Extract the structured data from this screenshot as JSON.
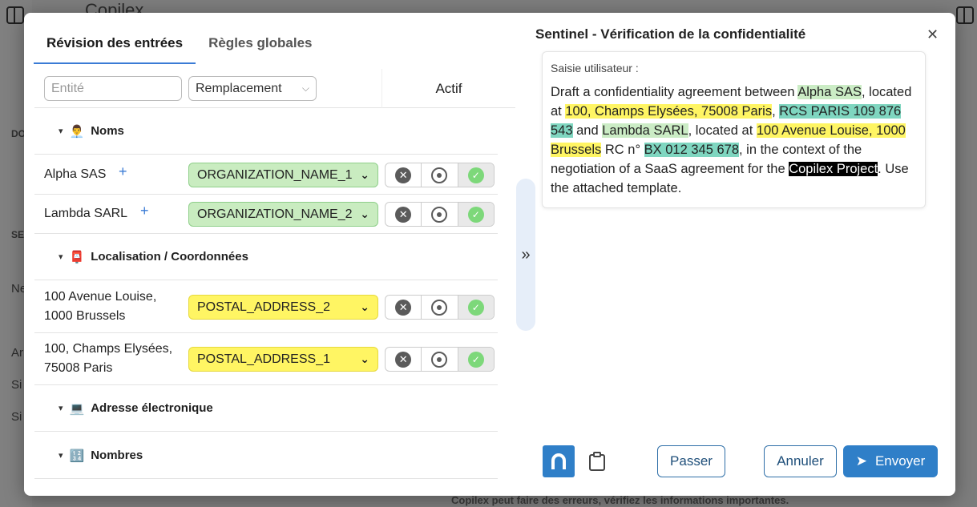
{
  "background": {
    "brand": "Copilex",
    "sidebar_letters": [
      "DO",
      "SE",
      "Ne",
      "Ar",
      "Si",
      "Si"
    ],
    "footer_text": "Copilex peut faire des erreurs, vérifiez les informations importantes."
  },
  "tabs": [
    {
      "label": "Révision des entrées",
      "active": true
    },
    {
      "label": "Règles globales",
      "active": false
    }
  ],
  "filters": {
    "entity_placeholder": "Entité",
    "replacement_label": "Remplacement",
    "active_header": "Actif"
  },
  "sections": [
    {
      "icon": "👨‍💼",
      "label": "Noms"
    },
    {
      "icon": "📮",
      "label": "Localisation / Coordonnées"
    },
    {
      "icon": "💻",
      "label": "Adresse électronique"
    },
    {
      "icon": "🔢",
      "label": "Nombres"
    }
  ],
  "rows": [
    {
      "label": "Alpha SAS",
      "tag": "ORGANIZATION_NAME_1",
      "color": "green"
    },
    {
      "label": "Lambda SARL",
      "tag": "ORGANIZATION_NAME_2",
      "color": "green"
    },
    {
      "label": "100 Avenue Louise, 1000 Brussels",
      "tag": "POSTAL_ADDRESS_2",
      "color": "yellow"
    },
    {
      "label": "100, Champs Elysées, 75008 Paris",
      "tag": "POSTAL_ADDRESS_1",
      "color": "yellow"
    }
  ],
  "right_panel": {
    "title": "Sentinel - Vérification de la confidentialité",
    "card_label": "Saisie utilisateur :",
    "text": {
      "t1": "Draft a confidentiality agreement between ",
      "h1": "Alpha SAS",
      "t2": ", located at ",
      "h2": "100, Champs Elysées, 75008 Paris",
      "t3": ", ",
      "h3": "RCS PARIS 109 876 543",
      "t4": " and ",
      "h4": "Lambda SARL",
      "t5": ", located at ",
      "h5": "100 Avenue Louise, 1000 Brussels",
      "t6": " RC n° ",
      "h6": "BX 012 345 678",
      "t7": ", in the context of the negotiation of a SaaS agreement for the ",
      "h7": "Copilex Project",
      "t8": ". Use the attached template."
    }
  },
  "buttons": {
    "skip": "Passer",
    "cancel": "Annuler",
    "send": "Envoyer"
  },
  "colors": {
    "accent": "#2f7fc8",
    "tag_green": "#c9ecc0",
    "tag_yellow": "#fff563",
    "highlight_teal": "#7fd6c0"
  }
}
